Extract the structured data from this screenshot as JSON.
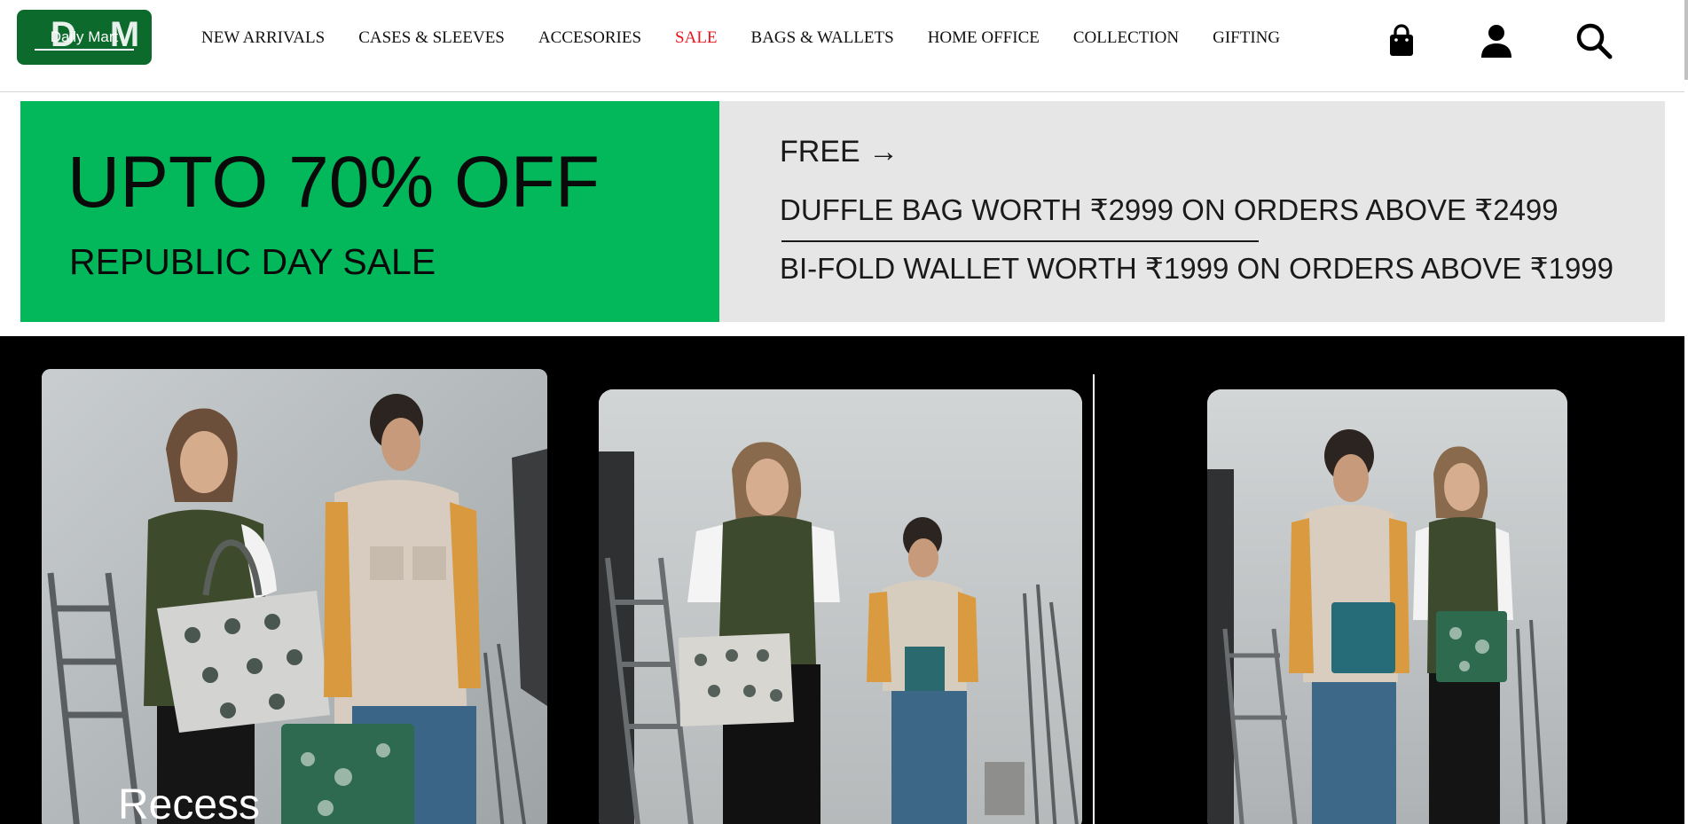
{
  "brand": {
    "logo_mark": "DM",
    "logo_text": "Daily Mart",
    "color": "#0c6b2c"
  },
  "nav": {
    "items": [
      {
        "label": "NEW ARRIVALS"
      },
      {
        "label": "CASES & SLEEVES"
      },
      {
        "label": "ACCESORIES"
      },
      {
        "label": "SALE",
        "color": "#e8141c"
      },
      {
        "label": "BAGS & WALLETS"
      },
      {
        "label": "HOME OFFICE"
      },
      {
        "label": "COLLECTION"
      },
      {
        "label": "GIFTING"
      }
    ],
    "icons": [
      "shopping-bag-icon",
      "user-icon",
      "search-icon"
    ]
  },
  "banner": {
    "headline": "UPTO 70% OFF",
    "subheadline": "REPUBLIC DAY SALE",
    "free_label": "FREE →",
    "offer_1": "DUFFLE BAG WORTH ₹2999 ON ORDERS ABOVE ₹2499",
    "offer_2": "BI-FOLD WALLET WORTH ₹1999 ON ORDERS ABOVE ₹1999",
    "left_color": "#02b85a",
    "right_color": "#e6e6e6"
  },
  "hero": {
    "caption": "Recess",
    "background": "#000000"
  }
}
